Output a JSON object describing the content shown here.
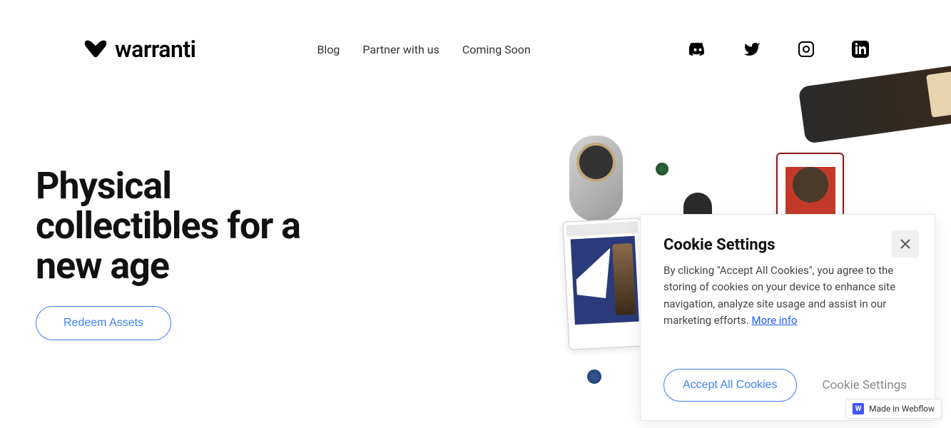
{
  "logo": {
    "text": "warranti"
  },
  "nav": {
    "blog": "Blog",
    "partner": "Partner with us",
    "coming_soon": "Coming Soon"
  },
  "hero": {
    "title_line1": "Physical",
    "title_line2": "collectibles for a",
    "title_line3": "new age",
    "cta": "Redeem Assets"
  },
  "cookie": {
    "title": "Cookie Settings",
    "text": "By clicking \"Accept All Cookies\", you agree to the storing of cookies on your device to enhance site navigation, analyze site usage and assist in our marketing efforts. ",
    "more_info": "More info",
    "accept": "Accept All Cookies",
    "settings": "Cookie Settings"
  },
  "webflow": {
    "text": "Made in Webflow"
  }
}
